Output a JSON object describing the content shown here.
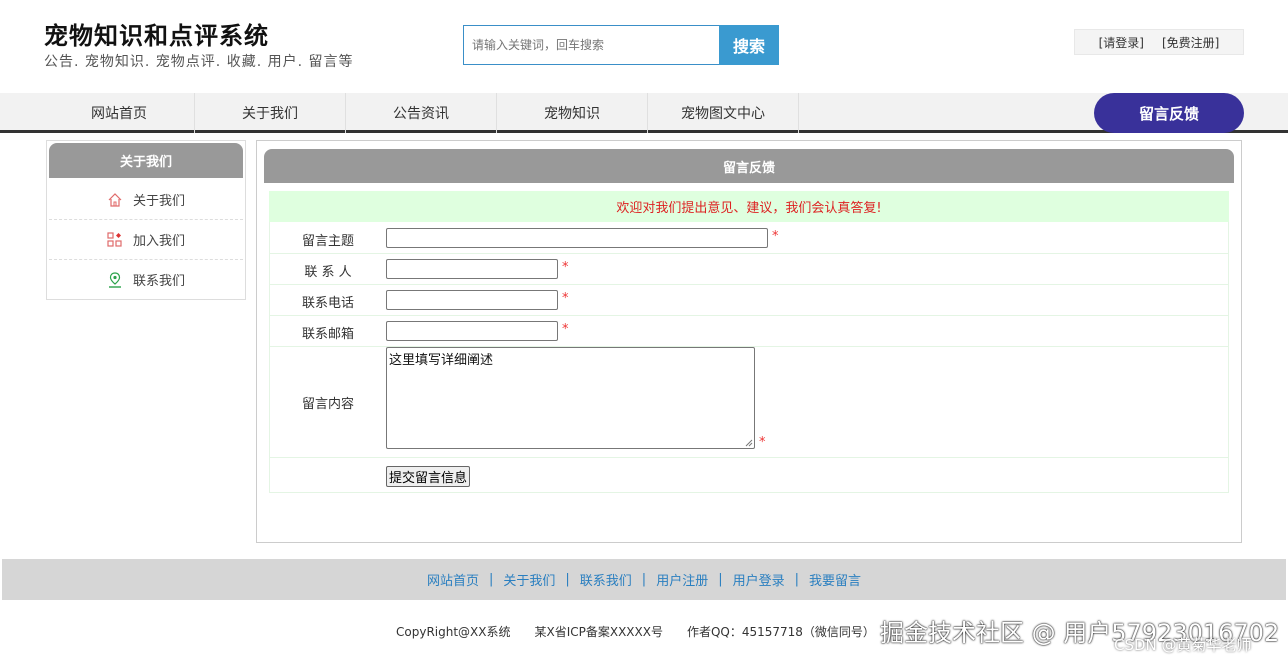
{
  "header": {
    "title": "宠物知识和点评系统",
    "subtitle": "公告. 宠物知识. 宠物点评. 收藏. 用户. 留言等",
    "search_placeholder": "请输入关键词，回车搜索",
    "search_button": "搜索",
    "login": "[请登录]",
    "register": "[免费注册]"
  },
  "nav": {
    "items": [
      "网站首页",
      "关于我们",
      "公告资讯",
      "宠物知识",
      "宠物图文中心"
    ],
    "feedback": "留言反馈"
  },
  "sidebar": {
    "title": "关于我们",
    "items": [
      {
        "label": "关于我们",
        "icon": "home-icon"
      },
      {
        "label": "加入我们",
        "icon": "apps-icon"
      },
      {
        "label": "联系我们",
        "icon": "location-icon"
      }
    ]
  },
  "main": {
    "title": "留言反馈",
    "welcome": "欢迎对我们提出意见、建议，我们会认真答复!",
    "form": {
      "subject_label": "留言主题",
      "contact_label": "联 系 人",
      "phone_label": "联系电话",
      "email_label": "联系邮箱",
      "content_label": "留言内容",
      "content_value": "这里填写详细阐述",
      "required_mark": "*",
      "submit": "提交留言信息"
    }
  },
  "footer": {
    "links": [
      "网站首页",
      "关于我们",
      "联系我们",
      "用户注册",
      "用户登录",
      "我要留言"
    ],
    "separator": "|",
    "copyright": "CopyRight@XX系统　　某X省ICP备案XXXXX号　　作者QQ：45157718（微信同号）",
    "watermark": "掘金技术社区 @ 用户57923016702",
    "watermark2": "CSDN @黄菊华老师"
  },
  "colors": {
    "accent": "#39319a",
    "search": "#3a9ad0",
    "panel_head": "#999999",
    "welcome_bg": "#dfffdf",
    "required": "#e33333"
  }
}
